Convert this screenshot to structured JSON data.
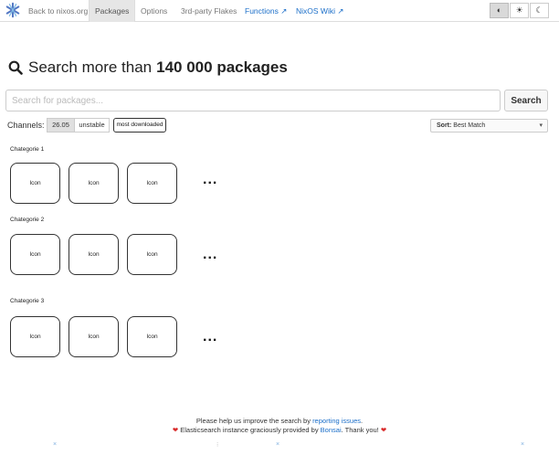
{
  "nav": {
    "items": [
      {
        "label": "Back to nixos.org"
      },
      {
        "label": "Packages"
      },
      {
        "label": "Options"
      },
      {
        "label": "3rd-party Flakes"
      },
      {
        "label": "Functions ↗"
      },
      {
        "label": "NixOS Wiki ↗"
      }
    ],
    "theme": [
      "◐",
      "☀",
      "☾"
    ]
  },
  "heading": {
    "prefix": "Search more than",
    "count": "140 000 packages"
  },
  "search": {
    "placeholder": "Search for packages...",
    "button": "Search"
  },
  "channels": {
    "label": "Channels:",
    "options": [
      "26.05",
      "unstable"
    ],
    "most_downloaded": "most downloaded"
  },
  "sort": {
    "label": "Sort:",
    "value": "Best Match"
  },
  "categories": [
    {
      "title": "Chategorie 1",
      "icons": [
        "Icon",
        "Icon",
        "Icon"
      ]
    },
    {
      "title": "Chategorie 2",
      "icons": [
        "Icon",
        "Icon",
        "Icon"
      ]
    },
    {
      "title": "Chategorie 3",
      "icons": [
        "Icon",
        "Icon",
        "Icon"
      ]
    }
  ],
  "more": "...",
  "footer": {
    "line1_prefix": "Please help us improve the search by",
    "line1_link": "reporting issues",
    "line1_suffix": ".",
    "heart": "❤",
    "line2_prefix": "Elasticsearch instance graciously provided by",
    "line2_link": "Bonsai",
    "line2_suffix": ". Thank you!"
  },
  "colors": {
    "link": "#1c6fc9",
    "heart": "#d92a2a"
  }
}
